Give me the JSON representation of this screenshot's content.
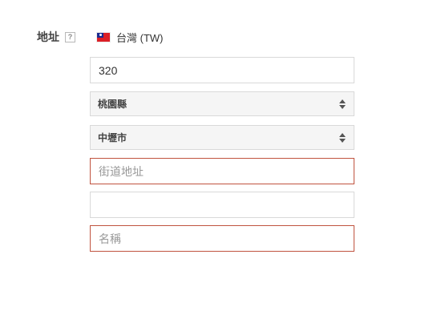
{
  "address": {
    "label": "地址",
    "help_icon": "question-mark-icon",
    "help_glyph": "?",
    "country": {
      "flag_icon": "taiwan-flag-icon",
      "text": "台灣 (TW)"
    },
    "postal_code": {
      "value": "320",
      "placeholder": ""
    },
    "county_select": {
      "value": "桃園縣"
    },
    "city_select": {
      "value": "中壢市"
    },
    "street_address": {
      "value": "",
      "placeholder": "街道地址"
    },
    "address_line_2": {
      "value": "",
      "placeholder": ""
    },
    "name": {
      "value": "",
      "placeholder": "名稱"
    }
  },
  "colors": {
    "error_border": "#c0533f",
    "field_border": "#d9d9d9",
    "select_bg": "#f5f5f5"
  }
}
